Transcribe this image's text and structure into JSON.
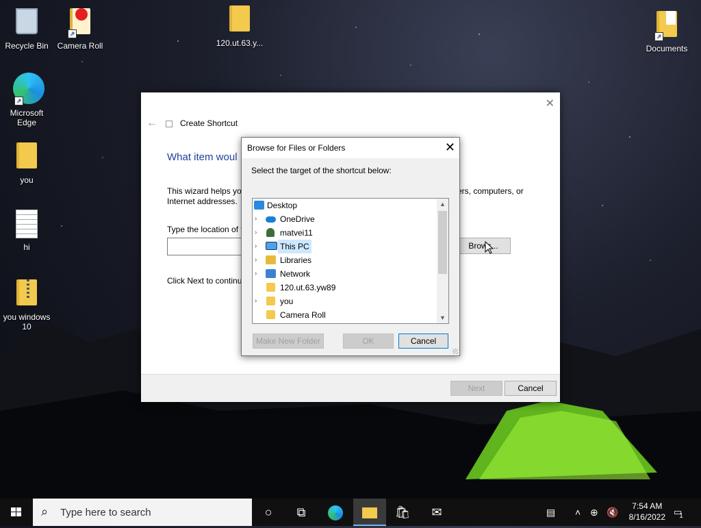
{
  "desktop": {
    "icons": [
      {
        "label": "Recycle Bin"
      },
      {
        "label": "Camera Roll"
      },
      {
        "label": "120.ut.63.y..."
      },
      {
        "label": "Documents"
      },
      {
        "label": "Microsoft Edge"
      },
      {
        "label": "you"
      },
      {
        "label": "hi"
      },
      {
        "label": "you windows 10"
      }
    ]
  },
  "wizard": {
    "title": "Create Shortcut",
    "heading": "What item woul",
    "description": "This wizard helps you",
    "description_line2": "Internet addresses.",
    "description_right": "ers, computers, or",
    "location_label": "Type the location of t",
    "location_value": "",
    "browse_label": "Brows...",
    "next_hint": "Click Next to continu",
    "next_label": "Next",
    "cancel_label": "Cancel"
  },
  "browse_dialog": {
    "title": "Browse for Files or Folders",
    "prompt": "Select the target of the shortcut below:",
    "tree": [
      {
        "label": "Desktop",
        "level": 0,
        "expandable": false,
        "icon": "desktop-icon",
        "selected": false
      },
      {
        "label": "OneDrive",
        "level": 1,
        "expandable": true,
        "icon": "cloud-icon",
        "selected": false
      },
      {
        "label": "matvei11",
        "level": 1,
        "expandable": true,
        "icon": "user-icon",
        "selected": false
      },
      {
        "label": "This PC",
        "level": 1,
        "expandable": true,
        "icon": "computer-icon",
        "selected": true
      },
      {
        "label": "Libraries",
        "level": 1,
        "expandable": true,
        "icon": "library-icon",
        "selected": false
      },
      {
        "label": "Network",
        "level": 1,
        "expandable": true,
        "icon": "network-icon",
        "selected": false
      },
      {
        "label": "120.ut.63.yw89",
        "level": 1,
        "expandable": false,
        "icon": "folder-icon",
        "selected": false
      },
      {
        "label": "you",
        "level": 1,
        "expandable": true,
        "icon": "folder-icon",
        "selected": false
      },
      {
        "label": "Camera Roll",
        "level": 1,
        "expandable": false,
        "icon": "folder-shortcut-icon",
        "selected": false
      }
    ],
    "make_new_folder_label": "Make New Folder",
    "ok_label": "OK",
    "cancel_label": "Cancel"
  },
  "taskbar": {
    "search_placeholder": "Type here to search",
    "time": "7:54 AM",
    "date": "8/16/2022",
    "notification_count": "1"
  },
  "colors": {
    "accent": "#0078d7",
    "selection": "#cce8ff",
    "wizard_heading": "#1f3f9f",
    "taskbar": "#101010"
  }
}
